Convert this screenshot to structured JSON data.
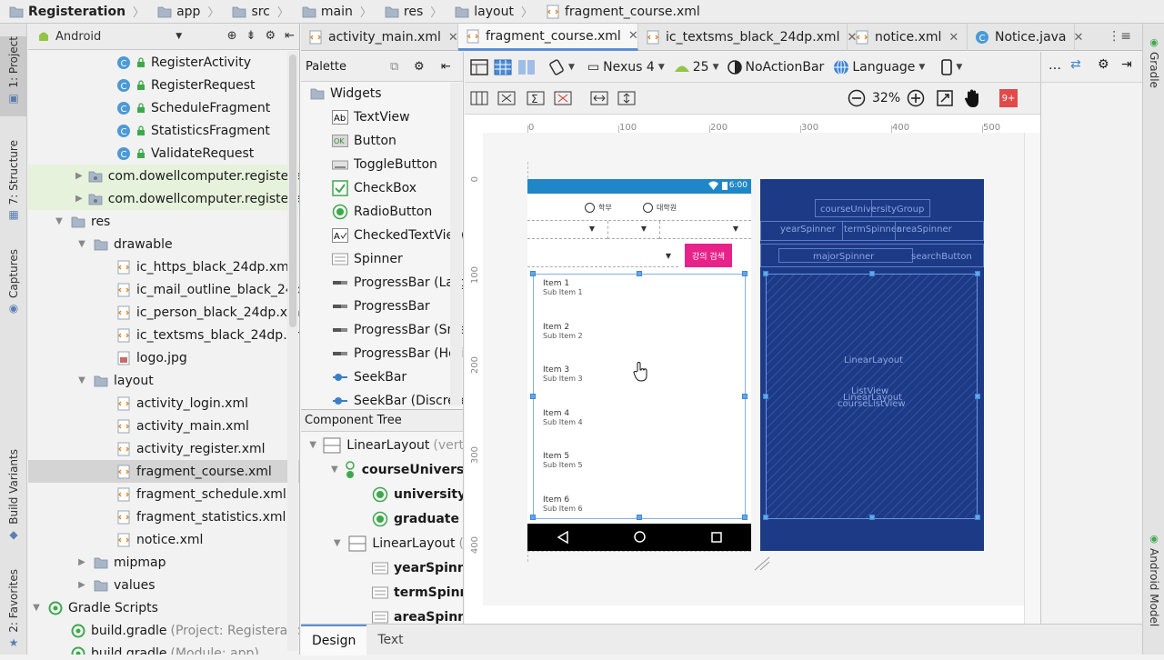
{
  "breadcrumb": [
    "Registeration",
    "app",
    "src",
    "main",
    "res",
    "layout",
    "fragment_course.xml"
  ],
  "left_tool_tabs": [
    "1: Project",
    "7: Structure",
    "Captures",
    "Build Variants",
    "2: Favorites"
  ],
  "right_tool_tabs": [
    "Gradle",
    "Android Model"
  ],
  "project": {
    "view_mode": "Android",
    "tree": [
      {
        "label": "RegisterActivity",
        "kind": "class",
        "indent": 3
      },
      {
        "label": "RegisterRequest",
        "kind": "class",
        "indent": 3
      },
      {
        "label": "ScheduleFragment",
        "kind": "class",
        "indent": 3
      },
      {
        "label": "StatisticsFragment",
        "kind": "class",
        "indent": 3
      },
      {
        "label": "ValidateRequest",
        "kind": "class",
        "indent": 3
      },
      {
        "label": "com.dowellcomputer.registera",
        "kind": "package",
        "indent": 2,
        "arrow": "▶"
      },
      {
        "label": "com.dowellcomputer.registera",
        "kind": "package",
        "indent": 2,
        "arrow": "▶"
      },
      {
        "label": "res",
        "kind": "folder",
        "indent": 1,
        "arrow": "▼"
      },
      {
        "label": "drawable",
        "kind": "folder",
        "indent": 2,
        "arrow": "▼"
      },
      {
        "label": "ic_https_black_24dp.xml",
        "kind": "xml",
        "indent": 3
      },
      {
        "label": "ic_mail_outline_black_24dp",
        "kind": "xml",
        "indent": 3
      },
      {
        "label": "ic_person_black_24dp.xml",
        "kind": "xml",
        "indent": 3
      },
      {
        "label": "ic_textsms_black_24dp.xml",
        "kind": "xml",
        "indent": 3
      },
      {
        "label": "logo.jpg",
        "kind": "image",
        "indent": 3
      },
      {
        "label": "layout",
        "kind": "folder",
        "indent": 2,
        "arrow": "▼"
      },
      {
        "label": "activity_login.xml",
        "kind": "xml",
        "indent": 3
      },
      {
        "label": "activity_main.xml",
        "kind": "xml",
        "indent": 3
      },
      {
        "label": "activity_register.xml",
        "kind": "xml",
        "indent": 3
      },
      {
        "label": "fragment_course.xml",
        "kind": "xml",
        "indent": 3
      },
      {
        "label": "fragment_schedule.xml",
        "kind": "xml",
        "indent": 3
      },
      {
        "label": "fragment_statistics.xml",
        "kind": "xml",
        "indent": 3
      },
      {
        "label": "notice.xml",
        "kind": "xml",
        "indent": 3
      },
      {
        "label": "mipmap",
        "kind": "folder",
        "indent": 2,
        "arrow": "▶"
      },
      {
        "label": "values",
        "kind": "folder",
        "indent": 2,
        "arrow": "▶"
      },
      {
        "label": "Gradle Scripts",
        "kind": "gradle",
        "indent": 0,
        "arrow": "▼"
      },
      {
        "label": "build.gradle",
        "kind": "gradle",
        "indent": 1,
        "note": "(Project: Registeratio"
      },
      {
        "label": "build.gradle",
        "kind": "gradle",
        "indent": 1,
        "note": "(Module: app)"
      }
    ]
  },
  "editor_tabs": [
    {
      "label": "activity_main.xml",
      "kind": "xml"
    },
    {
      "label": "fragment_course.xml",
      "kind": "xml"
    },
    {
      "label": "ic_textsms_black_24dp.xml",
      "kind": "xml"
    },
    {
      "label": "notice.xml",
      "kind": "xml"
    },
    {
      "label": "Notice.java",
      "kind": "class"
    }
  ],
  "palette": {
    "title": "Palette",
    "group": "Widgets",
    "items": [
      "TextView",
      "Button",
      "ToggleButton",
      "CheckBox",
      "RadioButton",
      "CheckedTextView",
      "Spinner",
      "ProgressBar (Larg",
      "ProgressBar",
      "ProgressBar (Sma",
      "ProgressBar (Hori",
      "SeekBar",
      "SeekBar (Discrete"
    ]
  },
  "component_tree": {
    "title": "Component Tree",
    "rows": [
      {
        "label": "LinearLayout",
        "note": "(vert",
        "bold": false,
        "arrow": "▼",
        "indent": 0
      },
      {
        "label": "courseUnivers",
        "bold": true,
        "arrow": "▼",
        "indent": 1
      },
      {
        "label": "university",
        "bold": true,
        "arrow": "",
        "indent": 2
      },
      {
        "label": "graduate",
        "bold": true,
        "arrow": "",
        "indent": 2
      },
      {
        "label": "LinearLayout",
        "note": "(",
        "bold": false,
        "arrow": "▼",
        "indent": 1
      },
      {
        "label": "yearSpinn",
        "bold": true,
        "arrow": "",
        "indent": 2
      },
      {
        "label": "termSpinn",
        "bold": true,
        "arrow": "",
        "indent": 2
      },
      {
        "label": "areaSpinn",
        "bold": true,
        "arrow": "",
        "indent": 2
      }
    ]
  },
  "toolbar": {
    "device": "Nexus 4",
    "api": "25",
    "theme": "NoActionBar",
    "language": "Language",
    "zoom": "32%"
  },
  "ruler": {
    "h": [
      "0",
      "100",
      "200",
      "300",
      "400",
      "500"
    ],
    "v": [
      "0",
      "100",
      "200",
      "300",
      "400"
    ]
  },
  "phone": {
    "time": "6:00",
    "radio1": "학부",
    "radio2": "대학원",
    "search_button": "강의 검색",
    "list_items": [
      {
        "title": "Item 1",
        "sub": "Sub Item 1"
      },
      {
        "title": "Item 2",
        "sub": "Sub Item 2"
      },
      {
        "title": "Item 3",
        "sub": "Sub Item 3"
      },
      {
        "title": "Item 4",
        "sub": "Sub Item 4"
      },
      {
        "title": "Item 5",
        "sub": "Sub Item 5"
      },
      {
        "title": "Item 6",
        "sub": "Sub Item 6"
      }
    ]
  },
  "blueprint": {
    "top_labels": [
      "courseUniversityGroup"
    ],
    "spinner_labels": [
      "yearSpinner",
      "termSpinner",
      "areaSpinner"
    ],
    "row3_labels": [
      "majorSpinner",
      "searchButton"
    ],
    "center_labels": [
      "LinearLayout",
      "ListView",
      "LinearLayout",
      "courseListView"
    ]
  },
  "bottom_tabs": [
    "Design",
    "Text"
  ],
  "colors": {
    "accent": "#e7238a",
    "statusbar": "#1f86c8",
    "blueprint": "#1d3a86",
    "selection": "#d4d4d4"
  }
}
